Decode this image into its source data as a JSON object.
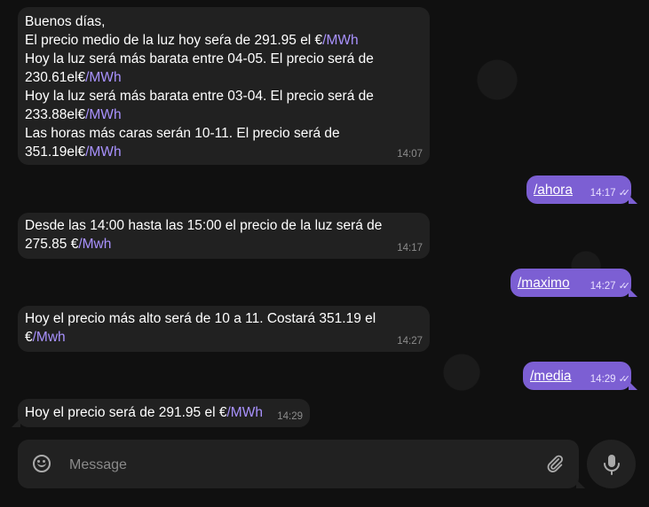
{
  "messages": [
    {
      "type": "in",
      "lines": [
        {
          "text": "Buenos días,",
          "cmd": ""
        },
        {
          "text": "El precio medio de la luz hoy seŕa de 291.95 el €",
          "cmd": "/MWh"
        },
        {
          "text": "Hoy la luz será más barata entre 04-05. El precio será de",
          "cmd": ""
        },
        {
          "text": "230.61el€",
          "cmd": "/MWh"
        },
        {
          "text": "Hoy la luz será más barata entre 03-04. El precio será de",
          "cmd": ""
        },
        {
          "text": "233.88el€",
          "cmd": "/MWh"
        },
        {
          "text": "Las horas más caras serán 10-11. El precio será de",
          "cmd": ""
        },
        {
          "text": "351.19el€",
          "cmd": "/MWh"
        }
      ],
      "time": "14:07"
    },
    {
      "type": "out",
      "text": "/ahora",
      "time": "14:17",
      "ticks": "✓✓"
    },
    {
      "type": "in",
      "lines": [
        {
          "text": "Desde las 14:00 hasta las 15:00 el precio de la luz será de",
          "cmd": ""
        },
        {
          "text": "275.85 €",
          "cmd": "/Mwh"
        }
      ],
      "time": "14:17"
    },
    {
      "type": "out",
      "text": "/maximo",
      "time": "14:27",
      "ticks": "✓✓"
    },
    {
      "type": "in",
      "lines": [
        {
          "text": "Hoy el precio más alto será de 10 a 11. Costará 351.19 el",
          "cmd": ""
        },
        {
          "text": "€",
          "cmd": "/Mwh"
        }
      ],
      "time": "14:27"
    },
    {
      "type": "out",
      "text": "/media",
      "time": "14:29",
      "ticks": "✓✓"
    },
    {
      "type": "in",
      "lines": [
        {
          "text": "Hoy el precio será de 291.95 el €",
          "cmd": "/MWh"
        }
      ],
      "time": "14:29"
    }
  ],
  "composer": {
    "placeholder": "Message",
    "icons": {
      "emoji": "smile-icon",
      "attach": "paperclip-icon",
      "send": "microphone-icon"
    }
  },
  "colors": {
    "outgoing": "#7c5fd3",
    "incoming": "#212121",
    "command": "#a992ff"
  }
}
